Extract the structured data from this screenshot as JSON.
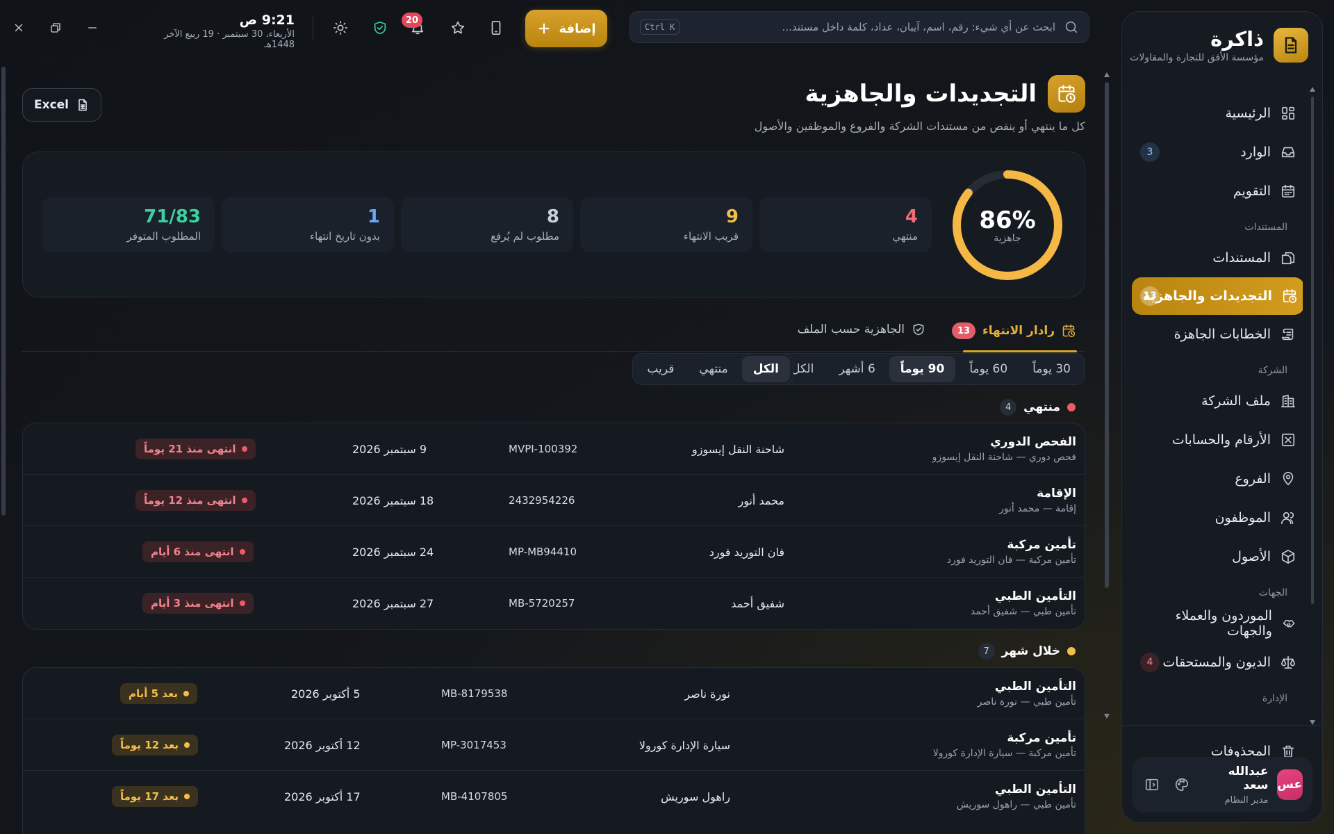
{
  "sidebar": {
    "brand_name": "ذاكرة",
    "brand_sub": "مؤسسة الأفق للتجارة والمقاولات",
    "items": [
      {
        "label": "الرئيسية"
      },
      {
        "label": "الوارد",
        "badge": "3"
      },
      {
        "label": "التقويم"
      },
      {
        "section": "المستندات"
      },
      {
        "label": "المستندات"
      },
      {
        "label": "التجديدات والجاهزية",
        "badge": "13"
      },
      {
        "label": "الخطابات الجاهزة"
      },
      {
        "section": "الشركة"
      },
      {
        "label": "ملف الشركة"
      },
      {
        "label": "الأرقام والحسابات"
      },
      {
        "label": "الفروع"
      },
      {
        "label": "الموظفون"
      },
      {
        "label": "الأصول"
      },
      {
        "section": "الجهات"
      },
      {
        "label": "الموردون والعملاء والجهات"
      },
      {
        "label": "الديون والمستحقات",
        "badge": "4"
      },
      {
        "section": "الإدارة"
      }
    ],
    "trash_label": "المحذوفات",
    "user": {
      "initials": "عس",
      "name": "عبدالله سعد",
      "role": "مدير النظام"
    }
  },
  "topbar": {
    "search_placeholder": "ابحث عن أي شيء: رقم، اسم، آيبان، عداد، كلمة داخل مستند...",
    "search_shortcut": "Ctrl K",
    "add_label": "إضافة",
    "notifications_count": "20",
    "time": "9:21 ص",
    "date": "الأربعاء، 30 سبتمبر · 19 ربيع الآخر 1448هـ"
  },
  "page": {
    "title": "التجديدات والجاهزية",
    "subtitle": "كل ما ينتهي أو ينقص من مستندات الشركة والفروع والموظفين والأصول",
    "excel_label": "Excel"
  },
  "stats": {
    "readiness_pct": "86%",
    "readiness_value": 0.86,
    "readiness_label": "جاهزية",
    "cards": [
      {
        "num": "4",
        "label": "منتهي",
        "color": "#f26d78"
      },
      {
        "num": "9",
        "label": "قريب الانتهاء",
        "color": "#f2be4a"
      },
      {
        "num": "8",
        "label": "مطلوب لم يُرفع",
        "color": "#c9d0da"
      },
      {
        "num": "1",
        "label": "بدون تاريخ انتهاء",
        "color": "#6ea8f5"
      },
      {
        "num": "71/83",
        "label": "المطلوب المتوفر",
        "color": "#3ed1a0"
      }
    ]
  },
  "tabs": {
    "radar_label": "رادار الانتهاء",
    "radar_count": "13",
    "readiness_label": "الجاهزية حسب الملف"
  },
  "filters": {
    "range": [
      "30 يوماً",
      "60 يوماً",
      "90 يوماً",
      "6 أشهر",
      "الكل"
    ],
    "range_selected": "90 يوماً",
    "status": [
      "الكل",
      "منتهي",
      "قريب"
    ],
    "status_selected": "الكل"
  },
  "groups": [
    {
      "title": "منتهي",
      "count": "4",
      "color": "#ef5a68",
      "rows": [
        {
          "title": "الفحص الدوري",
          "sub": "فحص دوري — شاحنة النقل إيسوزو",
          "holder": "شاحنة النقل إيسوزو",
          "number": "MVPI-100392",
          "date": "9 سبتمبر 2026",
          "status": "انتهى منذ 21 يوماً"
        },
        {
          "title": "الإقامة",
          "sub": "إقامة — محمد أنور",
          "holder": "محمد أنور",
          "number": "2432954226",
          "date": "18 سبتمبر 2026",
          "status": "انتهى منذ 12 يوماً"
        },
        {
          "title": "تأمين مركبة",
          "sub": "تأمين مركبة — فان التوريد فورد",
          "holder": "فان التوريد فورد",
          "number": "MP-MB94410",
          "date": "24 سبتمبر 2026",
          "status": "انتهى منذ 6 أيام"
        },
        {
          "title": "التأمين الطبي",
          "sub": "تأمين طبي — شفيق أحمد",
          "holder": "شفيق أحمد",
          "number": "MB-5720257",
          "date": "27 سبتمبر 2026",
          "status": "انتهى منذ 3 أيام"
        }
      ]
    },
    {
      "title": "خلال شهر",
      "count": "7",
      "color": "#f2be4a",
      "rows": [
        {
          "title": "التأمين الطبي",
          "sub": "تأمين طبي — نورة ناصر",
          "holder": "نورة ناصر",
          "number": "MB-8179538",
          "date": "5 أكتوبر 2026",
          "status": "بعد 5 أيام"
        },
        {
          "title": "تأمين مركبة",
          "sub": "تأمين مركبة — سيارة الإدارة كورولا",
          "holder": "سيارة الإدارة كورولا",
          "number": "MP-3017453",
          "date": "12 أكتوبر 2026",
          "status": "بعد 12 يوماً"
        },
        {
          "title": "التأمين الطبي",
          "sub": "تأمين طبي — راهول سوريش",
          "holder": "راهول سوريش",
          "number": "MB-4107805",
          "date": "17 أكتوبر 2026",
          "status": "بعد 17 يوماً"
        }
      ]
    }
  ]
}
